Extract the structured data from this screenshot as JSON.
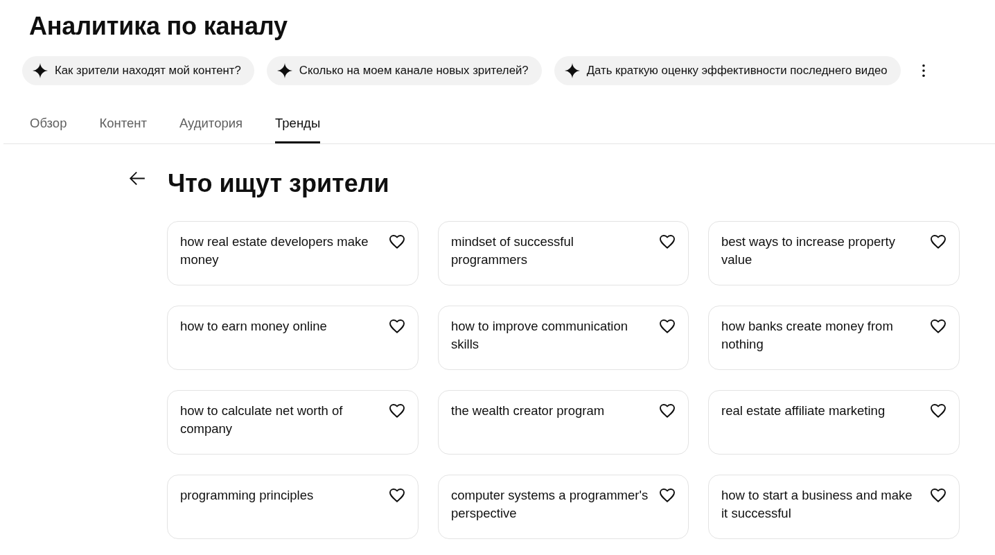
{
  "page": {
    "title": "Аналитика по каналу"
  },
  "suggestions": [
    "Как зрители находят мой контент?",
    "Сколько на моем канале новых зрителей?",
    "Дать краткую оценку эффективности последнего видео"
  ],
  "tabs": [
    {
      "label": "Обзор",
      "selected": false
    },
    {
      "label": "Контент",
      "selected": false
    },
    {
      "label": "Аудитория",
      "selected": false
    },
    {
      "label": "Тренды",
      "selected": true
    }
  ],
  "section": {
    "title": "Что ищут зрители"
  },
  "searches": [
    "how real estate developers make money",
    "mindset of successful programmers",
    "best ways to increase property value",
    "how to earn money online",
    "how to improve communication skills",
    "how banks create money from nothing",
    "how to calculate net worth of company",
    "the wealth creator program",
    "real estate affiliate marketing",
    "programming principles",
    "computer systems a programmer's perspective",
    "how to start a business and make it successful"
  ]
}
